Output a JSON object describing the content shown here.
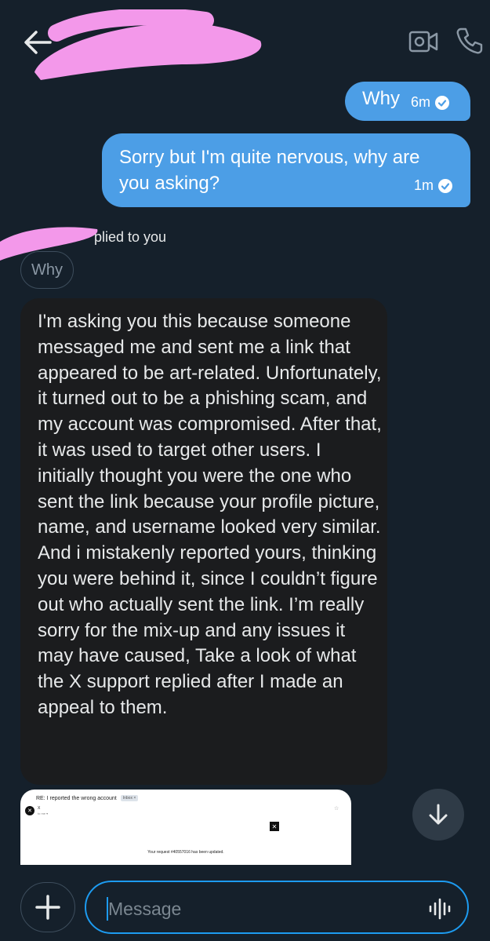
{
  "header": {
    "back_icon": "arrow-left-icon",
    "video_icon": "video-camera-icon",
    "phone_icon": "phone-icon",
    "redaction_color": "#f398ea"
  },
  "messages": {
    "outgoing": [
      {
        "text": "Why",
        "time": "6m"
      },
      {
        "text": "Sorry but I'm quite nervous, why are you asking?",
        "time": "1m"
      }
    ],
    "reply_context": {
      "label": "plied to you",
      "quoted": "Why"
    },
    "incoming": {
      "text": "I'm asking you this because someone messaged me and sent me a link that appeared to be art-related. Unfortunately, it turned out to be a phishing scam, and my account was compromised. After that, it was used to target other users. I initially thought you were the one who sent the link because your profile picture, name, and username looked very similar. And i mistakenly reported yours, thinking you were behind it, since I couldn’t figure out who actually sent the link. I’m really sorry for the mix-up and any issues it may have caused, Take a look of what the X support replied after I made an appeal to them."
    },
    "attachment": {
      "subject": "RE: I reported the wrong account",
      "badge": "Inbox ×",
      "sender": "X",
      "body": "Your request #40557016 has been updated."
    }
  },
  "composer": {
    "placeholder": "Message",
    "add_icon": "plus-icon",
    "voice_icon": "voice-waveform-icon"
  },
  "colors": {
    "background": "#15202b",
    "outgoing_bubble": "#4c9ee6",
    "incoming_bubble": "#1b1c1e",
    "accent": "#1d9bf0"
  }
}
